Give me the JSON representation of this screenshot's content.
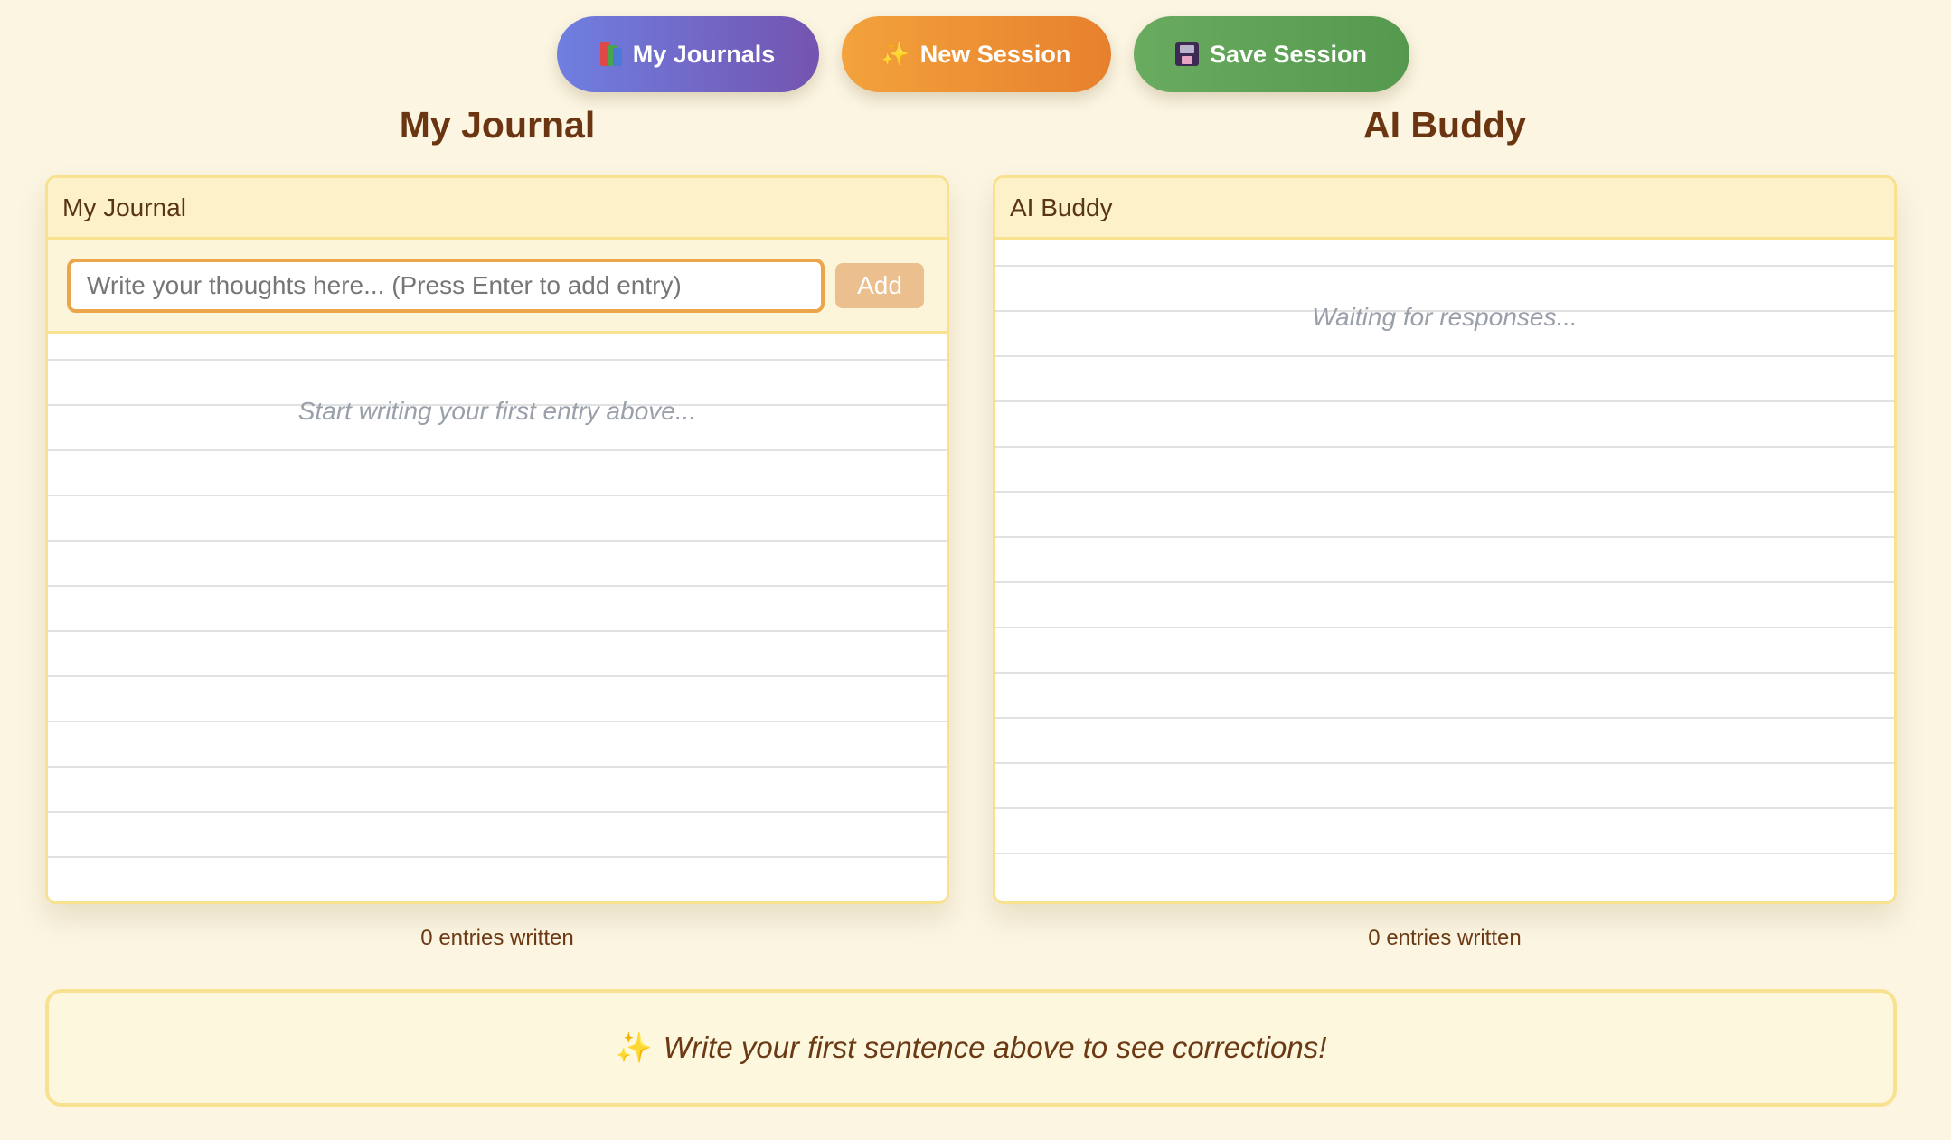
{
  "toolbar": {
    "journals": {
      "icon": "books-icon",
      "label": "My Journals",
      "color": "#7061c9"
    },
    "new_session": {
      "icon": "sparkles-icon",
      "label": "New Session",
      "color": "#ec8f33"
    },
    "save_session": {
      "icon": "floppy-disk-icon",
      "label": "Save Session",
      "color": "#5fa257"
    }
  },
  "journal": {
    "title": "My Journal",
    "header": "My Journal",
    "input": {
      "value": "",
      "placeholder": "Write your thoughts here... (Press Enter to add entry)"
    },
    "add_label": "Add",
    "empty_text": "Start writing your first entry above...",
    "count_text": "0 entries written"
  },
  "buddy": {
    "title": "AI Buddy",
    "header": "AI Buddy",
    "empty_text": "Waiting for responses...",
    "count_text": "0 entries written"
  },
  "banner": {
    "icon": "sparkles-icon",
    "text": "Write your first sentence above to see corrections!"
  },
  "colors": {
    "background": "#fbf5e2",
    "panel_border": "#f8e18f",
    "heading": "#6b3512",
    "input_border": "#eba54a",
    "add_button": "#ebbf8e"
  }
}
